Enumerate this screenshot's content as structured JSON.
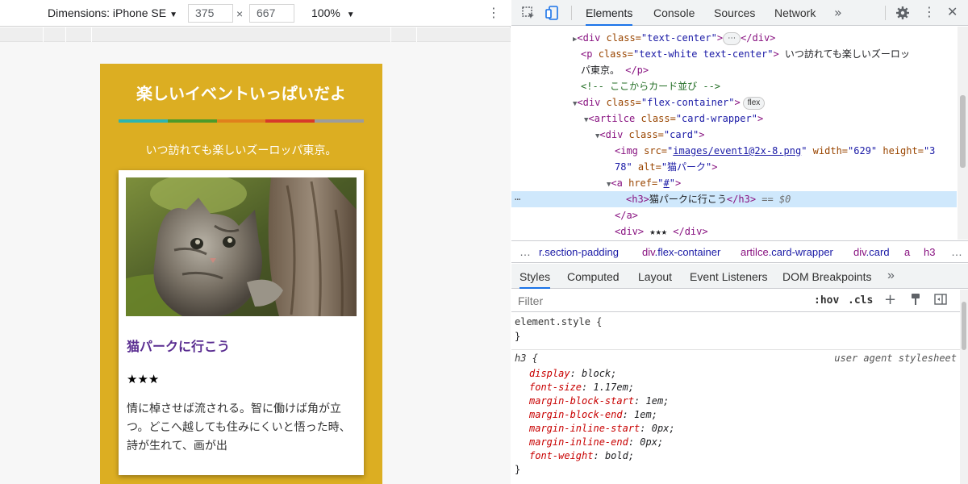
{
  "device_toolbar": {
    "dimensions_label": "Dimensions: iPhone SE",
    "caret": "▼",
    "width": "375",
    "times": "×",
    "height": "667",
    "zoom": "100%",
    "zoom_caret": "▼",
    "more": "⋮"
  },
  "phone": {
    "title": "楽しいイベントいっぱいだよ",
    "bar_colors": [
      "#2bb5b0",
      "#4c9a2a",
      "#e0801c",
      "#d7392a",
      "#9c9c9c"
    ],
    "subtitle": "いつ訪れても楽しいズーロッパ東京。",
    "card": {
      "title": "猫パークに行こう",
      "stars": "★★★",
      "description": "情に棹させば流される。智に働けば角が立つ。どこへ越しても住みにくいと悟った時、詩が生れて、画が出"
    }
  },
  "devtools": {
    "tabs": [
      "Elements",
      "Console",
      "Sources",
      "Network"
    ],
    "tabs_more": "»",
    "active_tab": "Elements",
    "dom": {
      "l1_tag_open": "<div ",
      "l1_attr": "class=",
      "l1_val": "\"text-center\"",
      "l1_close": ">",
      "l1_ellipsis": "⋯",
      "l1_end": "</div>",
      "l2_tag_open": "<p ",
      "l2_attr": "class=",
      "l2_val": "\"text-white text-center\"",
      "l2_close": ">",
      "l2_text_a": " いつ訪れても楽しいズーロッ",
      "l2_text_b": "パ東京。 ",
      "l2_end": "</p>",
      "comment": "<!-- ここからカード並び -->",
      "l4_tag_open": "<div ",
      "l4_attr": "class=",
      "l4_val": "\"flex-container\"",
      "l4_close": ">",
      "l4_pill": "flex",
      "l5_tag_open": "<artilce ",
      "l5_attr": "class=",
      "l5_val": "\"card-wrapper\"",
      "l5_close": ">",
      "l6_tag_open": "<div ",
      "l6_attr": "class=",
      "l6_val": "\"card\"",
      "l6_close": ">",
      "l7_tag_open": "<img ",
      "l7_attr_src": "src=",
      "l7_src": "images/event1@2x-8.png",
      "l7_attr_w": " width=",
      "l7_w": "\"629\"",
      "l7_attr_h": " height=",
      "l7_h": "\"3",
      "l7b_h": "78\"",
      "l7b_attr_alt": " alt=",
      "l7b_alt": "\"猫パーク\"",
      "l7b_close": ">",
      "l8_tag_open": "<a ",
      "l8_attr": "href=",
      "l8_q1": "\"",
      "l8_href": "#",
      "l8_q2": "\"",
      "l8_close": ">",
      "l9_dots": "⋯",
      "l9_open": "<h3>",
      "l9_text": "猫パークに行こう",
      "l9_close": "</h3>",
      "l9_eq": " == $0",
      "l10": "</a>",
      "l11_open": "<div>",
      "l11_text": " ★★★ ",
      "l11_close": "</div>"
    },
    "breadcrumbs": {
      "dots_left": "…",
      "items": [
        {
          "tag": "",
          "cls": "r.section-padding"
        },
        {
          "tag": "div",
          "cls": ".flex-container"
        },
        {
          "tag": "artilce",
          "cls": ".card-wrapper"
        },
        {
          "tag": "div",
          "cls": ".card"
        },
        {
          "tag": "a",
          "cls": ""
        },
        {
          "tag": "h3",
          "cls": ""
        }
      ],
      "dots_right": "…"
    },
    "subtabs": [
      "Styles",
      "Computed",
      "Layout",
      "Event Listeners",
      "DOM Breakpoints"
    ],
    "subtabs_more": "»",
    "filter_placeholder": "Filter",
    "filter_hov": ":hov",
    "filter_cls": ".cls",
    "filter_plus": "+",
    "styles": {
      "element_style": "element.style {",
      "close": "}",
      "h3_selector": "h3 {",
      "ua_label": "user agent stylesheet",
      "rules": [
        {
          "prop": "display",
          "value": "block;"
        },
        {
          "prop": "font-size",
          "value": "1.17em;"
        },
        {
          "prop": "margin-block-start",
          "value": "1em;"
        },
        {
          "prop": "margin-block-end",
          "value": "1em;"
        },
        {
          "prop": "margin-inline-start",
          "value": "0px;"
        },
        {
          "prop": "margin-inline-end",
          "value": "0px;"
        },
        {
          "prop": "font-weight",
          "value": "bold;"
        }
      ]
    }
  }
}
